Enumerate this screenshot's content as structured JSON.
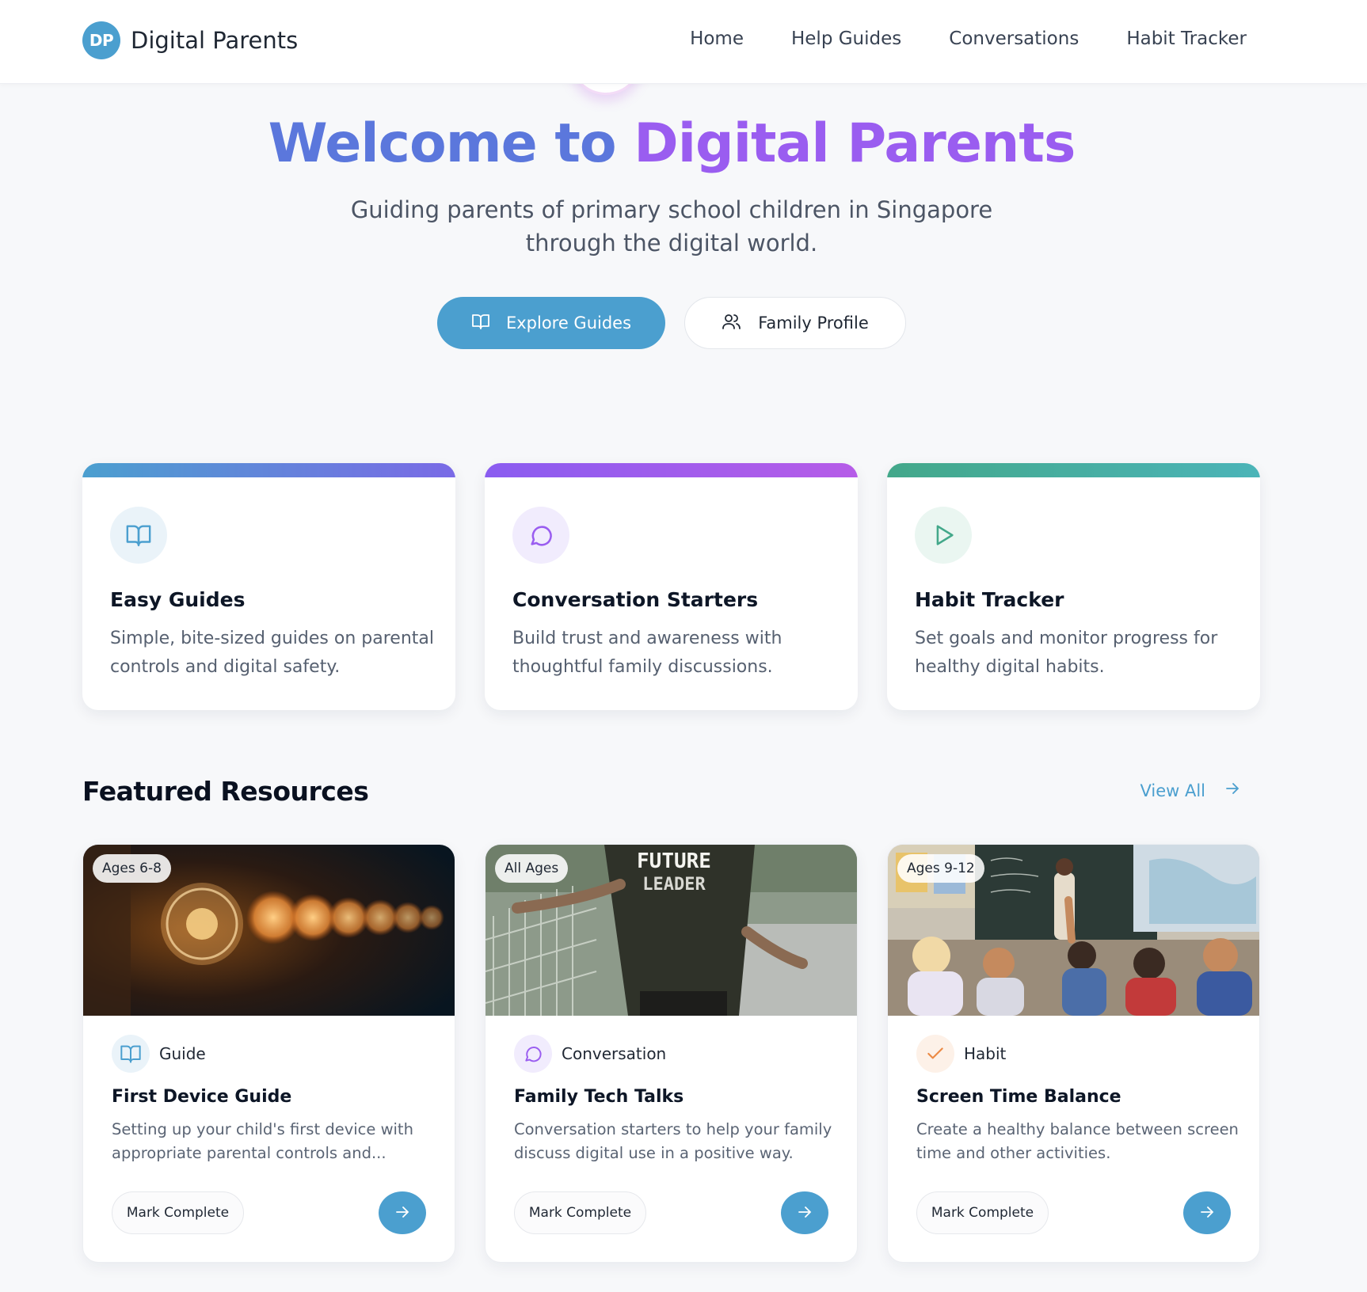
{
  "brand": {
    "logo_text": "DP",
    "name": "Digital Parents"
  },
  "nav": {
    "items": [
      {
        "label": "Home"
      },
      {
        "label": "Help Guides"
      },
      {
        "label": "Conversations"
      },
      {
        "label": "Habit Tracker"
      }
    ]
  },
  "hero": {
    "title_part1": "Welcome to",
    "title_part2": "Digital Parents",
    "subtitle": "Guiding parents of primary school children in Singapore through the digital world.",
    "primary_button": "Explore Guides",
    "secondary_button": "Family Profile"
  },
  "features": [
    {
      "title": "Easy Guides",
      "description": "Simple, bite-sized guides on parental controls and digital safety.",
      "icon": "book-icon",
      "accent": "#5b77dc"
    },
    {
      "title": "Conversation Starters",
      "description": "Build trust and awareness with thoughtful family discussions.",
      "icon": "chat-bubble-icon",
      "accent": "#9a5df0"
    },
    {
      "title": "Habit Tracker",
      "description": "Set goals and monitor progress for healthy digital habits.",
      "icon": "play-icon",
      "accent": "#43a88a"
    }
  ],
  "featured": {
    "title": "Featured Resources",
    "view_all": "View All",
    "cards": [
      {
        "age": "Ages 6-8",
        "type": "Guide",
        "type_icon": "book-icon",
        "title": "First Device Guide",
        "description": "Setting up your child's first device with appropriate parental controls and...",
        "button": "Mark Complete"
      },
      {
        "age": "All Ages",
        "type": "Conversation",
        "type_icon": "chat-bubble-icon",
        "title": "Family Tech Talks",
        "description": "Conversation starters to help your family discuss digital use in a positive way.",
        "button": "Mark Complete",
        "image_text": [
          "FUTURE",
          "LEADER"
        ]
      },
      {
        "age": "Ages 9-12",
        "type": "Habit",
        "type_icon": "check-icon",
        "title": "Screen Time Balance",
        "description": "Create a healthy balance between screen time and other activities.",
        "button": "Mark Complete"
      }
    ]
  },
  "colors": {
    "primary": "#4b9fcf",
    "title_blue": "#5b77dc",
    "title_purple": "#9a5df0",
    "green": "#43a88a"
  }
}
